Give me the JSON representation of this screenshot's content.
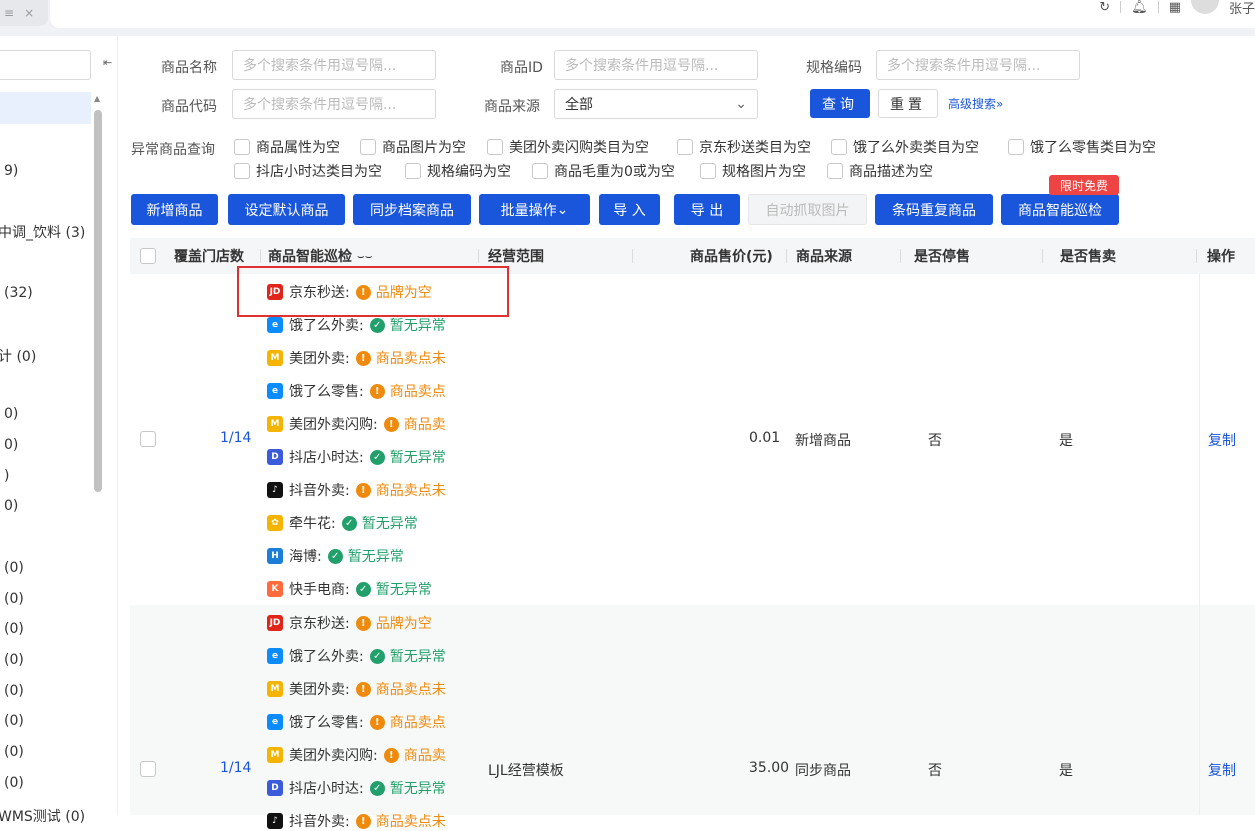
{
  "topbar": {
    "tab_fragment": "≡",
    "tab_close": "×",
    "user_name": "张子"
  },
  "sidebar": {
    "collapse_icon": "⇤",
    "items": [
      {
        "label": "9)"
      },
      {
        "label": "中调_饮料 (3)"
      },
      {
        "label": "(32)"
      },
      {
        "label": "计 (0)"
      },
      {
        "label": "0)"
      },
      {
        "label": "0)"
      },
      {
        "label": ")"
      },
      {
        "label": "0)"
      },
      {
        "label": "(0)"
      },
      {
        "label": "(0)"
      },
      {
        "label": "(0)"
      },
      {
        "label": "(0)"
      },
      {
        "label": "(0)"
      },
      {
        "label": "(0)"
      },
      {
        "label": "(0)"
      },
      {
        "label": "(0)"
      },
      {
        "label": "WMS测试 (0)"
      }
    ]
  },
  "filters": {
    "name_label": "商品名称",
    "name_placeholder": "多个搜索条件用逗号隔...",
    "id_label": "商品ID",
    "id_placeholder": "多个搜索条件用逗号隔...",
    "spec_label": "规格编码",
    "spec_placeholder": "多个搜索条件用逗号隔...",
    "code_label": "商品代码",
    "code_placeholder": "多个搜索条件用逗号隔...",
    "source_label": "商品来源",
    "source_value": "全部",
    "query": "查询",
    "reset": "重置",
    "advanced": "高级搜索"
  },
  "abnormal": {
    "label": "异常商品查询",
    "options": [
      "商品属性为空",
      "商品图片为空",
      "美团外卖闪购类目为空",
      "京东秒送类目为空",
      "饿了么外卖类目为空",
      "饿了么零售类目为空",
      "抖店小时达类目为空",
      "规格编码为空",
      "商品毛重为0或为空",
      "规格图片为空",
      "商品描述为空"
    ]
  },
  "actions": [
    "新增商品",
    "设定默认商品",
    "同步档案商品",
    "批量操作",
    "导 入",
    "导 出",
    "自动抓取图片",
    "条码重复商品",
    "商品智能巡检"
  ],
  "badge": "限时免费",
  "columns": {
    "stores": "覆盖门店数",
    "inspect": "商品智能巡检",
    "scope": "经营范围",
    "price": "商品售价(元)",
    "source": "商品来源",
    "stop": "是否停售",
    "sell": "是否售卖",
    "op": "操作"
  },
  "accent": "#1a56db",
  "rows": [
    {
      "stores": "1/14",
      "scope": "",
      "price": "0.01",
      "source": "新增商品",
      "stop": "否",
      "sell": "是",
      "op": "复制",
      "platforms": [
        {
          "name": "京东秒送:",
          "status": "品牌为空",
          "ok": false,
          "icon": "JD",
          "color": "#e1251b"
        },
        {
          "name": "饿了么外卖:",
          "status": "暂无异常",
          "ok": true,
          "icon": "e",
          "color": "#0a8cff"
        },
        {
          "name": "美团外卖:",
          "status": "商品卖点未",
          "ok": false,
          "icon": "M",
          "color": "#f5b400"
        },
        {
          "name": "饿了么零售:",
          "status": "商品卖点",
          "ok": false,
          "icon": "e",
          "color": "#0a8cff"
        },
        {
          "name": "美团外卖闪购:",
          "status": "商品卖",
          "ok": false,
          "icon": "M",
          "color": "#f5b400"
        },
        {
          "name": "抖店小时达:",
          "status": "暂无异常",
          "ok": true,
          "icon": "D",
          "color": "#3b5bdb"
        },
        {
          "name": "抖音外卖:",
          "status": "商品卖点未",
          "ok": false,
          "icon": "♪",
          "color": "#111"
        },
        {
          "name": "牵牛花:",
          "status": "暂无异常",
          "ok": true,
          "icon": "✿",
          "color": "#f5b400"
        },
        {
          "name": "海博:",
          "status": "暂无异常",
          "ok": true,
          "icon": "H",
          "color": "#1c7ed6"
        },
        {
          "name": "快手电商:",
          "status": "暂无异常",
          "ok": true,
          "icon": "K",
          "color": "#ff6b3d"
        }
      ]
    },
    {
      "stores": "1/14",
      "scope": "LJL经营模板",
      "price": "35.00",
      "source": "同步商品",
      "stop": "否",
      "sell": "是",
      "op": "复制",
      "platforms": [
        {
          "name": "京东秒送:",
          "status": "品牌为空",
          "ok": false,
          "icon": "JD",
          "color": "#e1251b"
        },
        {
          "name": "饿了么外卖:",
          "status": "暂无异常",
          "ok": true,
          "icon": "e",
          "color": "#0a8cff"
        },
        {
          "name": "美团外卖:",
          "status": "商品卖点未",
          "ok": false,
          "icon": "M",
          "color": "#f5b400"
        },
        {
          "name": "饿了么零售:",
          "status": "商品卖点",
          "ok": false,
          "icon": "e",
          "color": "#0a8cff"
        },
        {
          "name": "美团外卖闪购:",
          "status": "商品卖",
          "ok": false,
          "icon": "M",
          "color": "#f5b400"
        },
        {
          "name": "抖店小时达:",
          "status": "暂无异常",
          "ok": true,
          "icon": "D",
          "color": "#3b5bdb"
        },
        {
          "name": "抖音外卖:",
          "status": "商品卖点未",
          "ok": false,
          "icon": "♪",
          "color": "#111"
        }
      ]
    }
  ]
}
